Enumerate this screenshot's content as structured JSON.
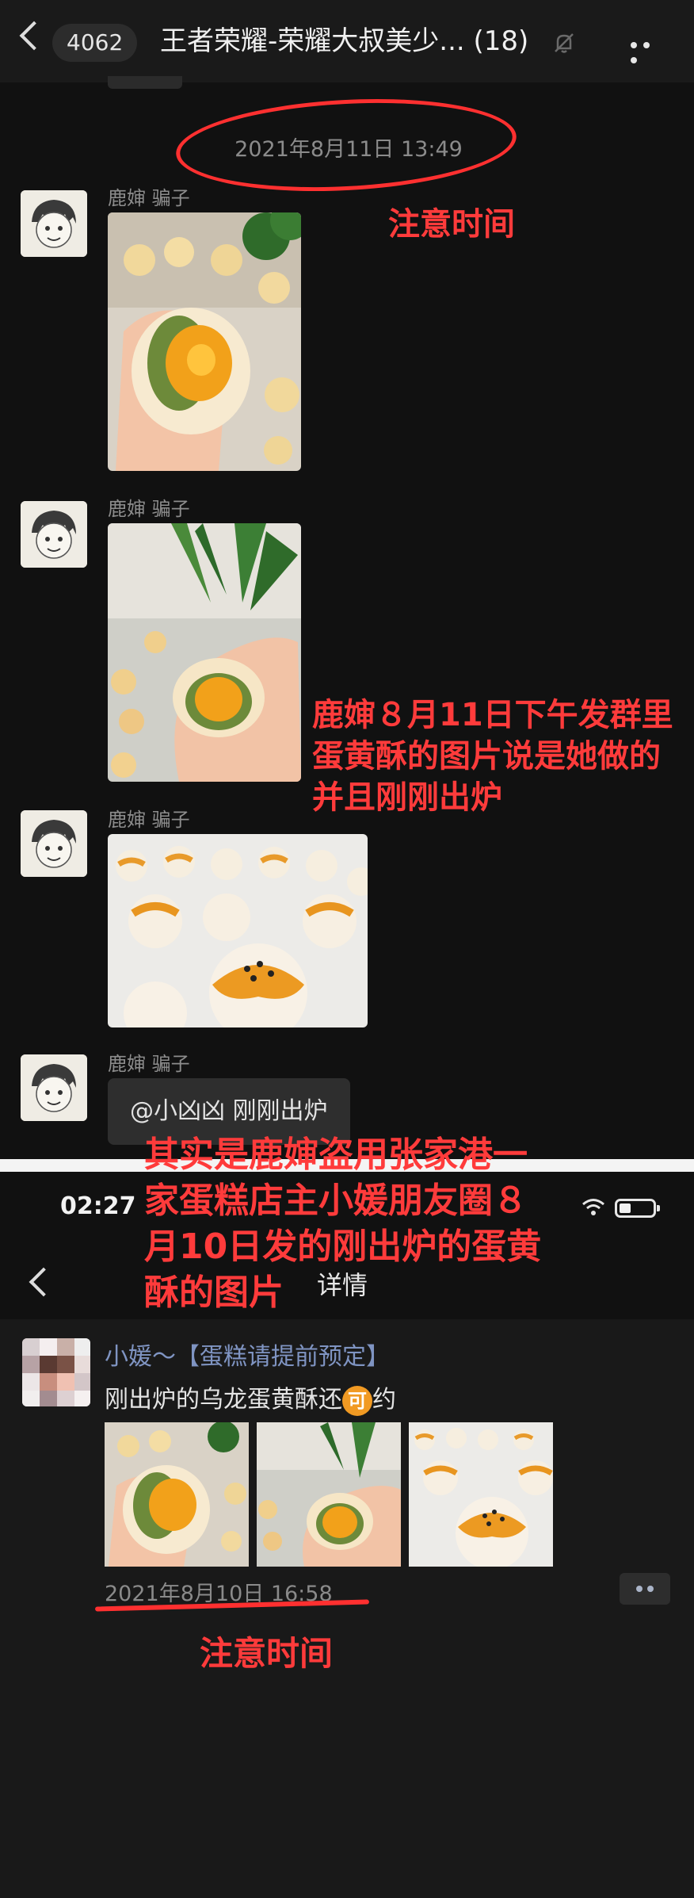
{
  "chat": {
    "unread_count": "4062",
    "title": "王者荣耀-荣耀大叔美少... (18)",
    "timestamp": "2021年8月11日 13:49",
    "messages": [
      {
        "sender": "鹿婶 骗子",
        "type": "image",
        "subject": "egg-yolk-pastry-bitten"
      },
      {
        "sender": "鹿婶 骗子",
        "type": "image",
        "subject": "egg-yolk-pastry-in-hand"
      },
      {
        "sender": "鹿婶 骗子",
        "type": "image",
        "subject": "egg-yolk-pastry-tray"
      },
      {
        "sender": "鹿婶 骗子",
        "type": "text",
        "text": "@小凶凶 刚刚出炉"
      }
    ]
  },
  "annotations": {
    "note_time_top": "注意时间",
    "claim": [
      "鹿婶８月11日下午发群里",
      "蛋黄酥的图片说是她做的",
      "并且刚刚出炉"
    ],
    "reveal": [
      "其实是鹿婶盗用张家港一",
      "家蛋糕店主小媛朋友圈８",
      "月10日发的刚出炉的蛋黄",
      "酥的图片"
    ],
    "note_time_bottom": "注意时间",
    "color": "#ff3b3b"
  },
  "moments": {
    "status_time": "02:27",
    "page_title": "详情",
    "author": "小媛～【蛋糕请提前预定】",
    "text_before": "刚出炉的乌龙蛋黄酥还",
    "emoji_char": "可",
    "text_after": "约",
    "timestamp": "2021年8月10日 16:58",
    "name_color": "#7f94c2"
  }
}
